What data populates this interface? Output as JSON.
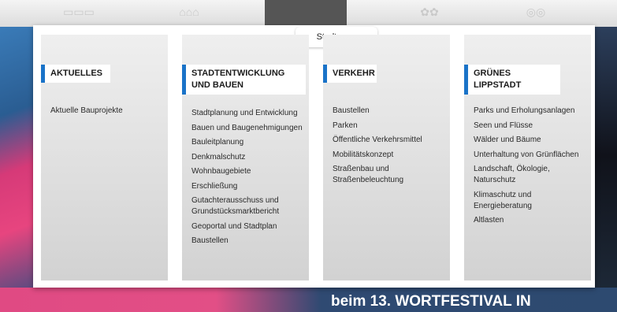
{
  "menu": {
    "tab_label": "Stadtraum",
    "columns": [
      {
        "heading": "AKTUELLES",
        "items": [
          "Aktuelle Bauprojekte"
        ]
      },
      {
        "heading": "STADTENTWICKLUNG UND BAUEN",
        "items": [
          "Stadtplanung und Entwicklung",
          "Bauen und Baugenehmigungen",
          "Bauleitplanung",
          "Denkmalschutz",
          "Wohnbaugebiete",
          "Erschließung",
          "Gutachterausschuss und Grundstücksmarktbericht",
          "Geoportal und Stadtplan",
          "Baustellen"
        ]
      },
      {
        "heading": "VERKEHR",
        "items": [
          "Baustellen",
          "Parken",
          "Öffentliche Verkehrsmittel",
          "Mobilitätskonzept",
          "Straßenbau und Straßenbeleuchtung"
        ]
      },
      {
        "heading": "GRÜNES LIPPSTADT",
        "items": [
          "Parks und Erholungsanlagen",
          "Seen und Flüsse",
          "Wälder und Bäume",
          "Unterhaltung von Grünflächen",
          "Landschaft, Ökologie, Naturschutz",
          "Klimaschutz und Energieberatung",
          "Altlasten"
        ]
      }
    ]
  },
  "background": {
    "headline": "beim 13. WORTFESTIVAL IN"
  },
  "colors": {
    "accent": "#1a73c8",
    "menu_bg": "#ffffff",
    "column_bg": "#dcdcdc"
  }
}
